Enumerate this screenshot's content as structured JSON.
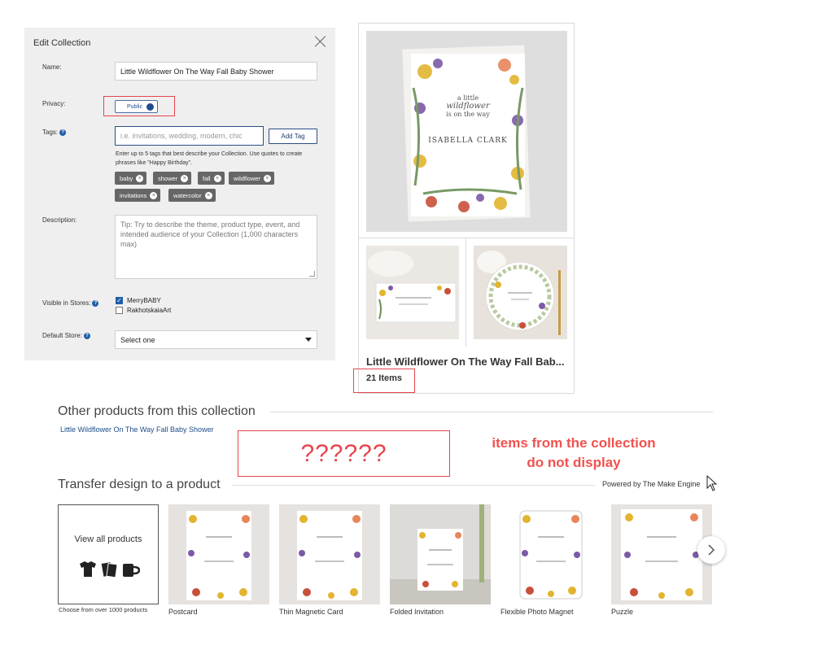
{
  "edit_panel": {
    "title": "Edit Collection",
    "name_label": "Name:",
    "name_value": "Little Wildflower On The Way Fall Baby Shower",
    "privacy_label": "Privacy:",
    "privacy_value": "Public",
    "tags_label": "Tags:",
    "tags_placeholder": "i.e. invitations, wedding, modern, chic",
    "add_tag_label": "Add Tag",
    "tags_hint": "Enter up to 5 tags that best describe your Collection. Use quotes to create phrases like \"Happy Birthday\".",
    "tags": [
      "baby",
      "shower",
      "fall",
      "wildflower",
      "invitations",
      "watercolor"
    ],
    "description_label": "Description:",
    "description_placeholder": "Tip: Try to describe the theme, product type, event, and intended audience of your Collection (1,000 characters max)",
    "visible_label": "Visible in Stores:",
    "stores": [
      {
        "name": "MerryBABY",
        "checked": true
      },
      {
        "name": "RakhotskaiaArt",
        "checked": false
      }
    ],
    "default_store_label": "Default Store:",
    "default_store_value": "Select one"
  },
  "collection_card": {
    "title": "Little Wildflower On The Way Fall Bab...",
    "count": "21 Items",
    "invite_text": {
      "line1": "a little",
      "line2": "wildflower",
      "line3": "is on the way",
      "name": "ISABELLA CLARK"
    }
  },
  "other_products": {
    "heading": "Other products from this collection",
    "link": "Little Wildflower On The Way Fall Baby Shower"
  },
  "annotation": {
    "placeholder": "??????",
    "note_line1": "items from the collection",
    "note_line2": "do not display"
  },
  "transfer": {
    "heading": "Transfer design to a product",
    "powered_by": "Powered by The Make Engine",
    "view_all_label": "View all products",
    "view_all_caption": "Choose from over 1000 products",
    "products": [
      "Postcard",
      "Thin Magnetic Card",
      "Folded Invitation",
      "Flexible Photo Magnet",
      "Puzzle"
    ]
  },
  "colors": {
    "highlight": "#e6454d",
    "note": "#f0524f",
    "link": "#1e4d8c",
    "chip": "#666666"
  }
}
